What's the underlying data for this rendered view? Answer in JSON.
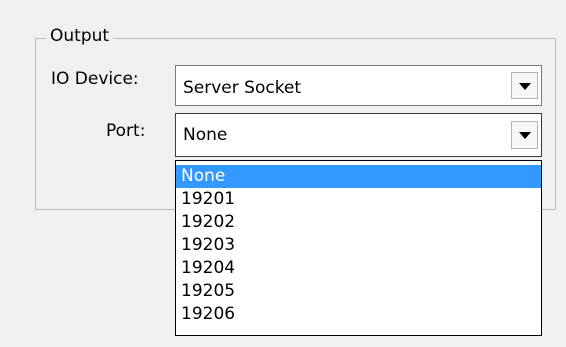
{
  "output_group": {
    "title": "Output",
    "io_device": {
      "label": "IO Device:",
      "value": "Server Socket"
    },
    "port": {
      "label": "Port:",
      "value": "None",
      "options": [
        "None",
        "19201",
        "19202",
        "19203",
        "19204",
        "19205",
        "19206"
      ],
      "highlighted_option": "None"
    }
  },
  "icons": {
    "dropdown_arrow": "chevron-down-icon"
  },
  "colors": {
    "highlight_bg": "#3399ff",
    "highlight_text": "#ffffff"
  }
}
